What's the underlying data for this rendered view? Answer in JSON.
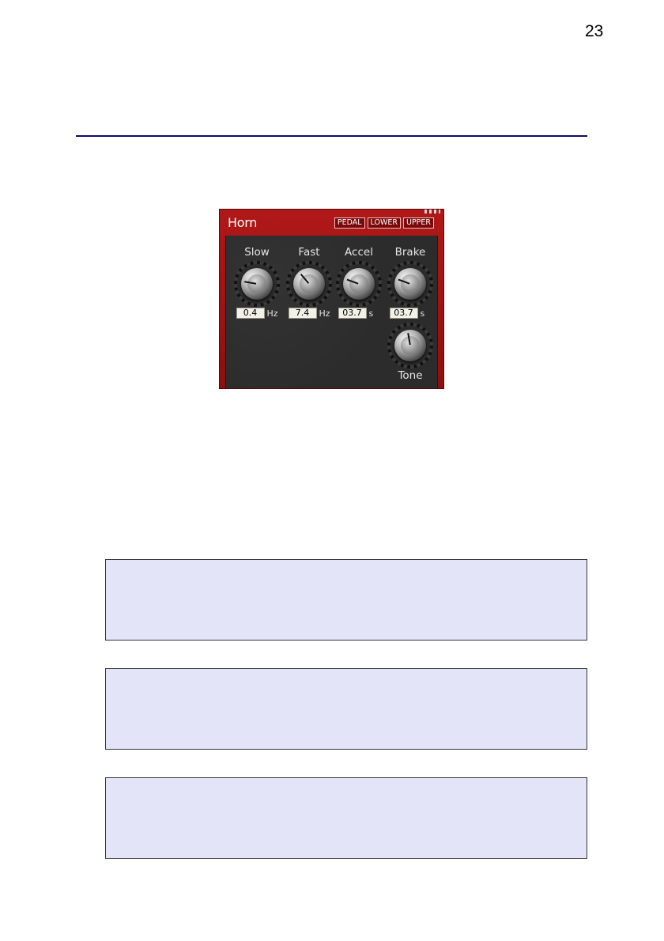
{
  "page": {
    "number": "23"
  },
  "horn_panel": {
    "title": "Horn",
    "tabs": [
      "PEDAL",
      "LOWER",
      "UPPER"
    ],
    "knobs": [
      {
        "label": "Slow",
        "value": "0.4",
        "unit": "Hz",
        "angle": -80
      },
      {
        "label": "Fast",
        "value": "7.4",
        "unit": "Hz",
        "angle": -40
      },
      {
        "label": "Accel",
        "value": "03.7",
        "unit": "s",
        "angle": -70
      },
      {
        "label": "Brake",
        "value": "03.7",
        "unit": "s",
        "angle": -70
      }
    ],
    "tone": {
      "label": "Tone",
      "angle": -10
    }
  },
  "note_boxes": [
    "",
    "",
    ""
  ]
}
